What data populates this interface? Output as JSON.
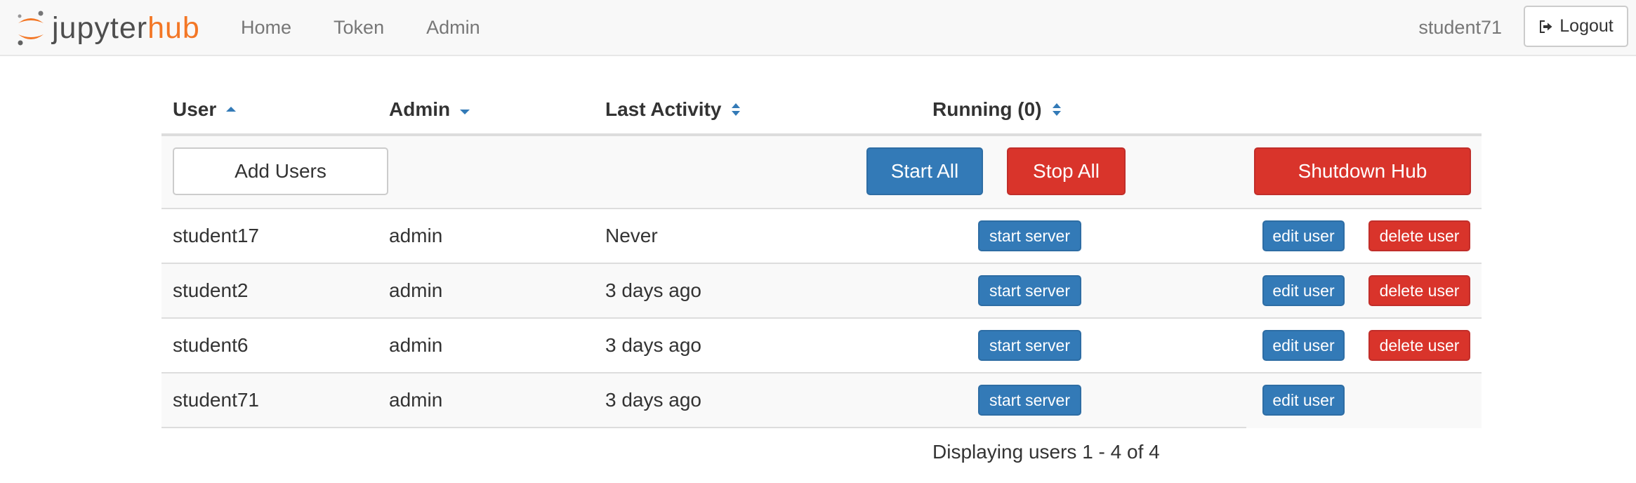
{
  "brand": {
    "part1": "jupyter",
    "part2": "hub"
  },
  "nav": {
    "links": [
      "Home",
      "Token",
      "Admin"
    ],
    "username": "student71",
    "logout_label": "Logout"
  },
  "table": {
    "headers": {
      "user": "User",
      "admin": "Admin",
      "last_activity": "Last Activity",
      "running": "Running (0)"
    },
    "controls": {
      "add_users": "Add Users",
      "start_all": "Start All",
      "stop_all": "Stop All",
      "shutdown_hub": "Shutdown Hub"
    },
    "action_labels": {
      "start_server": "start server",
      "edit_user": "edit user",
      "delete_user": "delete user"
    },
    "rows": [
      {
        "user": "student17",
        "admin": "admin",
        "last_activity": "Never"
      },
      {
        "user": "student2",
        "admin": "admin",
        "last_activity": "3 days ago"
      },
      {
        "user": "student6",
        "admin": "admin",
        "last_activity": "3 days ago"
      },
      {
        "user": "student71",
        "admin": "admin",
        "last_activity": "3 days ago"
      }
    ]
  },
  "footer": {
    "text": "Displaying users 1 - 4 of 4"
  },
  "colors": {
    "primary": "#337ab7",
    "danger": "#d9342b",
    "brand_orange": "#f37726"
  },
  "icons": {
    "logo": "jupyter-logo-icon",
    "logout": "sign-out-icon",
    "sort": "sort-caret-icon"
  }
}
